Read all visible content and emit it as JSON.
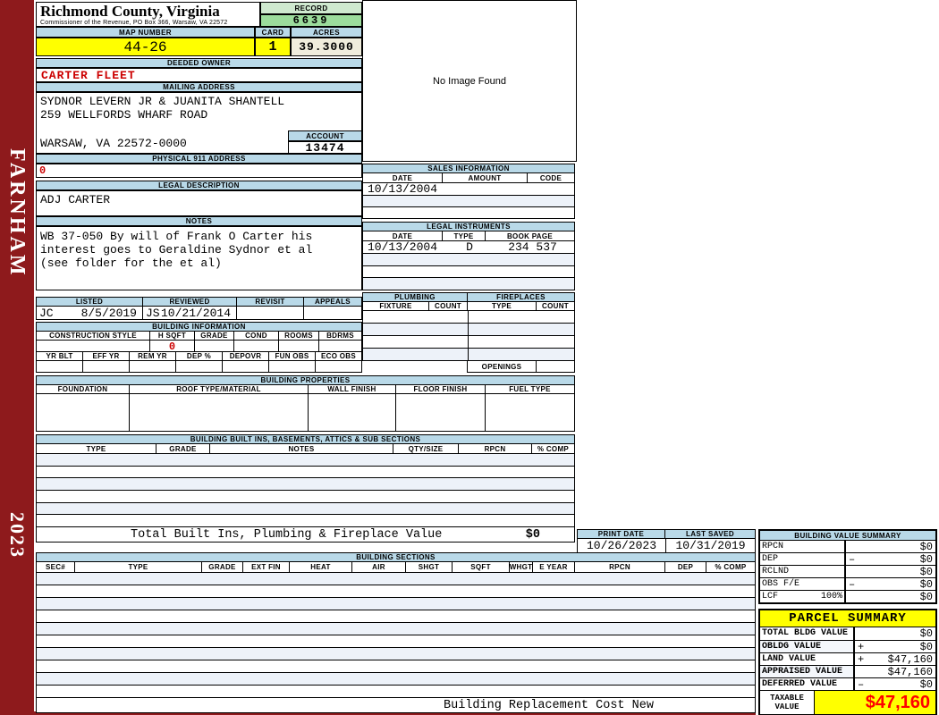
{
  "header": {
    "county": "Richmond County, Virginia",
    "commissioner_line": "Commissioner of the Revenue, PO Box 366, Warsaw, VA 22572",
    "record_label": "RECORD",
    "record_value": "6639",
    "map_number_label": "MAP NUMBER",
    "map_number": "44-26",
    "card_label": "CARD",
    "card_value": "1",
    "acres_label": "ACRES",
    "acres_value": "39.3000"
  },
  "sidebar": {
    "district": "FARNHAM",
    "year": "2023"
  },
  "owner": {
    "deeded_owner_label": "DEEDED OWNER",
    "deeded_owner": "CARTER FLEET",
    "mailing_address_label": "MAILING ADDRESS",
    "mailing_lines": [
      "SYDNOR LEVERN JR & JUANITA SHANTELL",
      "259 WELLFORDS WHARF ROAD",
      "",
      "WARSAW, VA 22572-0000"
    ],
    "account_label": "ACCOUNT",
    "account_value": "13474",
    "physical_address_label": "PHYSICAL 911 ADDRESS",
    "physical_address": "0",
    "legal_description_label": "LEGAL DESCRIPTION",
    "legal_description": "ADJ CARTER",
    "notes_label": "NOTES",
    "notes_lines": [
      "WB 37-050 By will of Frank O Carter his",
      "interest goes to Geraldine Sydnor et al",
      "(see folder for the et al)"
    ]
  },
  "image_panel": {
    "message": "No Image Found"
  },
  "sales_information": {
    "title": "SALES INFORMATION",
    "columns": [
      "DATE",
      "AMOUNT",
      "CODE"
    ],
    "rows": [
      {
        "date": "10/13/2004",
        "amount": "",
        "code": ""
      }
    ]
  },
  "legal_instruments": {
    "title": "LEGAL INSTRUMENTS",
    "columns": [
      "DATE",
      "TYPE",
      "BOOK PAGE"
    ],
    "rows": [
      {
        "date": "10/13/2004",
        "type": "D",
        "book_page": "234 537"
      }
    ]
  },
  "plumbing": {
    "title": "PLUMBING",
    "columns": [
      "FIXTURE",
      "COUNT"
    ]
  },
  "fireplaces": {
    "title": "FIREPLACES",
    "columns": [
      "TYPE",
      "COUNT"
    ],
    "openings_label": "OPENINGS"
  },
  "review": {
    "listed_label": "LISTED",
    "listed_by": "JC",
    "listed_date": "8/5/2019",
    "reviewed_label": "REVIEWED",
    "reviewed_by": "JS",
    "reviewed_date": "10/21/2014",
    "revisit_label": "REVISIT",
    "appeals_label": "APPEALS"
  },
  "building_information": {
    "title": "BUILDING INFORMATION",
    "row1_columns": [
      "CONSTRUCTION STYLE",
      "H SQFT",
      "GRADE",
      "COND",
      "ROOMS",
      "BDRMS"
    ],
    "h_sqft_value": "0",
    "row2_columns": [
      "YR BLT",
      "EFF YR",
      "REM YR",
      "DEP %",
      "DEPOVR",
      "FUN OBS",
      "ECO OBS"
    ]
  },
  "building_properties": {
    "title": "BUILDING PROPERTIES",
    "columns": [
      "FOUNDATION",
      "ROOF TYPE/MATERIAL",
      "WALL FINISH",
      "FLOOR FINISH",
      "FUEL TYPE"
    ]
  },
  "built_ins": {
    "title": "BUILDING BUILT INS, BASEMENTS, ATTICS & SUB SECTIONS",
    "columns": [
      "TYPE",
      "GRADE",
      "NOTES",
      "QTY/SIZE",
      "RPCN",
      "% COMP"
    ],
    "total_label": "Total Built Ins, Plumbing & Fireplace Value",
    "total_value": "$0"
  },
  "building_sections": {
    "title": "BUILDING SECTIONS",
    "columns": [
      "SEC#",
      "TYPE",
      "GRADE",
      "EXT FIN",
      "HEAT",
      "AIR",
      "SHGT",
      "SQFT",
      "WHGT",
      "E YEAR",
      "RPCN",
      "DEP",
      "% COMP"
    ],
    "footer_label": "Building Replacement Cost New"
  },
  "print_info": {
    "print_date_label": "PRINT DATE",
    "print_date": "10/26/2023",
    "last_saved_label": "LAST SAVED",
    "last_saved": "10/31/2019"
  },
  "building_value_summary": {
    "title": "BUILDING VALUE SUMMARY",
    "rows": [
      {
        "label": "RPCN",
        "sign": "",
        "value": "$0"
      },
      {
        "label": "DEP",
        "sign": "–",
        "value": "$0"
      },
      {
        "label": "RCLND",
        "sign": "",
        "value": "$0"
      },
      {
        "label": "OBS F/E",
        "sign": "–",
        "value": "$0"
      },
      {
        "label": "LCF",
        "pct": "100%",
        "sign": "",
        "value": "$0"
      }
    ]
  },
  "parcel_summary": {
    "title": "PARCEL SUMMARY",
    "rows": [
      {
        "label": "TOTAL BLDG VALUE",
        "sign": "",
        "value": "$0"
      },
      {
        "label": "OBLDG VALUE",
        "sign": "+",
        "value": "$0"
      },
      {
        "label": "LAND VALUE",
        "sign": "+",
        "value": "$47,160"
      },
      {
        "label": "APPRAISED VALUE",
        "sign": "",
        "value": "$47,160"
      },
      {
        "label": "DEFERRED VALUE",
        "sign": "–",
        "value": "$0"
      }
    ],
    "taxable_label": "TAXABLE VALUE",
    "taxable_value": "$47,160"
  },
  "colors": {
    "sidebar_maroon": "#8e1a1c",
    "header_blue": "#b9d9e8",
    "record_green": "#9cdc9c",
    "record_green_light": "#cfe9cf",
    "highlight_yellow": "#ffff00",
    "acres_cream": "#f0eddc",
    "row_tint": "#edf2f9",
    "alert_red": "#cc0000",
    "taxable_red": "#ff0000"
  }
}
